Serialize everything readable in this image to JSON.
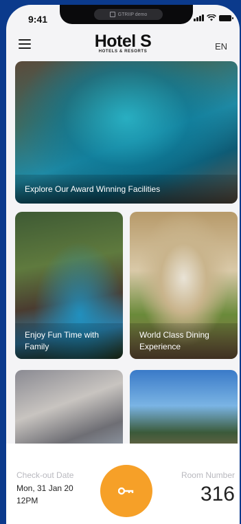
{
  "status": {
    "time": "9:41",
    "notch_label": "GTRIIP demo"
  },
  "header": {
    "logo_main": "Hotel S",
    "logo_sub": "HOTELS & RESORTS",
    "lang": "EN"
  },
  "cards": [
    {
      "caption": "Explore Our Award Winning Facilities"
    },
    {
      "caption": "Enjoy Fun Time with Family"
    },
    {
      "caption": "World Class Dining Experience"
    },
    {
      "caption": ""
    },
    {
      "caption": ""
    }
  ],
  "booking": {
    "checkout_label": "Check-out Date",
    "checkout_value": "Mon, 31 Jan 20 12PM",
    "room_label": "Room Number",
    "room_value": "316"
  },
  "icons": [
    "menu-icon",
    "signal-icon",
    "wifi-icon",
    "battery-icon",
    "key-icon"
  ],
  "colors": {
    "accent": "#f6a028",
    "background": "#0b3a8c"
  }
}
